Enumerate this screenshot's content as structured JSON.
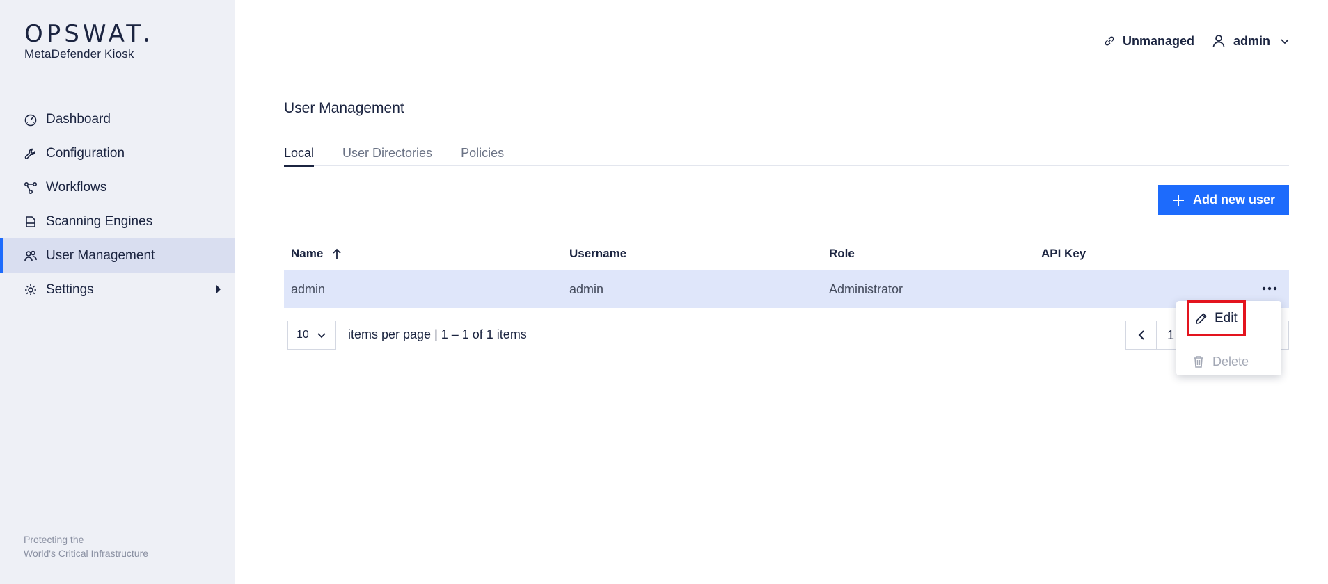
{
  "brand": {
    "logo_text": "OPSWAT",
    "product": "MetaDefender Kiosk",
    "footer_line1": "Protecting the",
    "footer_line2": "World's Critical Infrastructure"
  },
  "sidebar": {
    "items": [
      {
        "label": "Dashboard",
        "icon": "dashboard-icon"
      },
      {
        "label": "Configuration",
        "icon": "wrench-icon"
      },
      {
        "label": "Workflows",
        "icon": "workflow-icon"
      },
      {
        "label": "Scanning Engines",
        "icon": "scanning-engines-icon"
      },
      {
        "label": "User Management",
        "icon": "users-icon",
        "active": true
      },
      {
        "label": "Settings",
        "icon": "gear-icon",
        "has_submenu": true
      }
    ]
  },
  "header": {
    "status_label": "Unmanaged",
    "user_label": "admin"
  },
  "main": {
    "title": "User Management",
    "tabs": [
      {
        "label": "Local",
        "active": true
      },
      {
        "label": "User Directories"
      },
      {
        "label": "Policies"
      }
    ],
    "add_button_label": "Add new user",
    "table": {
      "columns": [
        "Name",
        "Username",
        "Role",
        "API Key"
      ],
      "rows": [
        {
          "name": "admin",
          "username": "admin",
          "role": "Administrator",
          "api_key": ""
        }
      ]
    },
    "pager": {
      "per_page": "10",
      "info": "items per page | 1 – 1 of 1 items",
      "current_page": "1"
    },
    "row_menu": {
      "edit_label": "Edit",
      "delete_label": "Delete"
    }
  },
  "colors": {
    "accent": "#1d6bfc",
    "sidebar_bg": "#eef0f6",
    "row_selected": "#dfe6fa",
    "highlight_border": "#e3141e"
  }
}
